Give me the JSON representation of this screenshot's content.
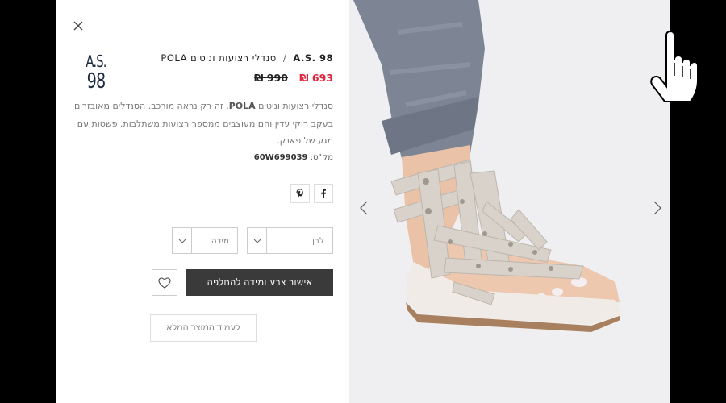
{
  "product": {
    "brand_logo_line1": "A.S.",
    "brand_logo_line2": "98",
    "brand": "A.S. 98",
    "separator": "/",
    "name": "סנדלי רצועות וניטים POLA",
    "price_current": "693 ₪",
    "price_original": "990 ₪",
    "description_bold": "POLA",
    "description_part1": "סנדלי רצועות וניטים ",
    "description_part2": ". זה רק נראה מורכב. הסנדלים מאובזרים בעקב רוקי עדין והם מעוצבים ממספר רצועות משתלבות. פשטות עם מגע של פאנק.",
    "sku_label": "מק\"ט: ",
    "sku_value": "60W699039"
  },
  "selectors": {
    "color_placeholder": "לבן",
    "size_placeholder": "מידה"
  },
  "actions": {
    "confirm_label": "אישור צבע ומידה להחלפה",
    "full_page_label": "לעמוד המוצר המלא"
  },
  "icons": {
    "close": "close-icon",
    "facebook": "facebook-icon",
    "pinterest": "pinterest-icon",
    "heart": "heart-icon",
    "prev": "chevron-left-icon",
    "next": "chevron-right-icon",
    "cursor": "hand-pointer-icon"
  },
  "colors": {
    "price_sale": "#e0233a",
    "button_dark": "#3a3a3a",
    "logo": "#1d2b3f"
  }
}
